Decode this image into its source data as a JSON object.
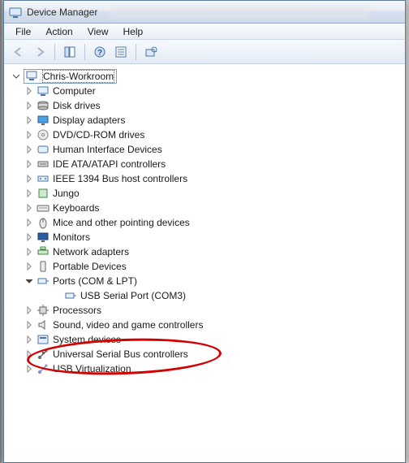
{
  "window": {
    "title": "Device Manager"
  },
  "menu": {
    "file": "File",
    "action": "Action",
    "view": "View",
    "help": "Help"
  },
  "root": {
    "name": "Chris-Workroom"
  },
  "cats": [
    {
      "name": "Computer",
      "icon": "computer-icon"
    },
    {
      "name": "Disk drives",
      "icon": "disk-icon"
    },
    {
      "name": "Display adapters",
      "icon": "display-icon"
    },
    {
      "name": "DVD/CD-ROM drives",
      "icon": "dvd-icon"
    },
    {
      "name": "Human Interface Devices",
      "icon": "hid-icon"
    },
    {
      "name": "IDE ATA/ATAPI controllers",
      "icon": "ide-icon"
    },
    {
      "name": "IEEE 1394 Bus host controllers",
      "icon": "ieee-icon"
    },
    {
      "name": "Jungo",
      "icon": "jungo-icon"
    },
    {
      "name": "Keyboards",
      "icon": "keyboard-icon"
    },
    {
      "name": "Mice and other pointing devices",
      "icon": "mouse-icon"
    },
    {
      "name": "Monitors",
      "icon": "monitor-icon"
    },
    {
      "name": "Network adapters",
      "icon": "network-icon"
    },
    {
      "name": "Portable Devices",
      "icon": "portable-icon"
    },
    {
      "name": "Ports (COM & LPT)",
      "icon": "port-icon",
      "expanded": true,
      "children": [
        {
          "name": "USB Serial Port (COM3)",
          "icon": "port-icon"
        }
      ]
    },
    {
      "name": "Processors",
      "icon": "cpu-icon"
    },
    {
      "name": "Sound, video and game controllers",
      "icon": "sound-icon"
    },
    {
      "name": "System devices",
      "icon": "system-icon"
    },
    {
      "name": "Universal Serial Bus controllers",
      "icon": "usb-icon"
    },
    {
      "name": "USB Virtualization",
      "icon": "usbv-icon"
    }
  ]
}
